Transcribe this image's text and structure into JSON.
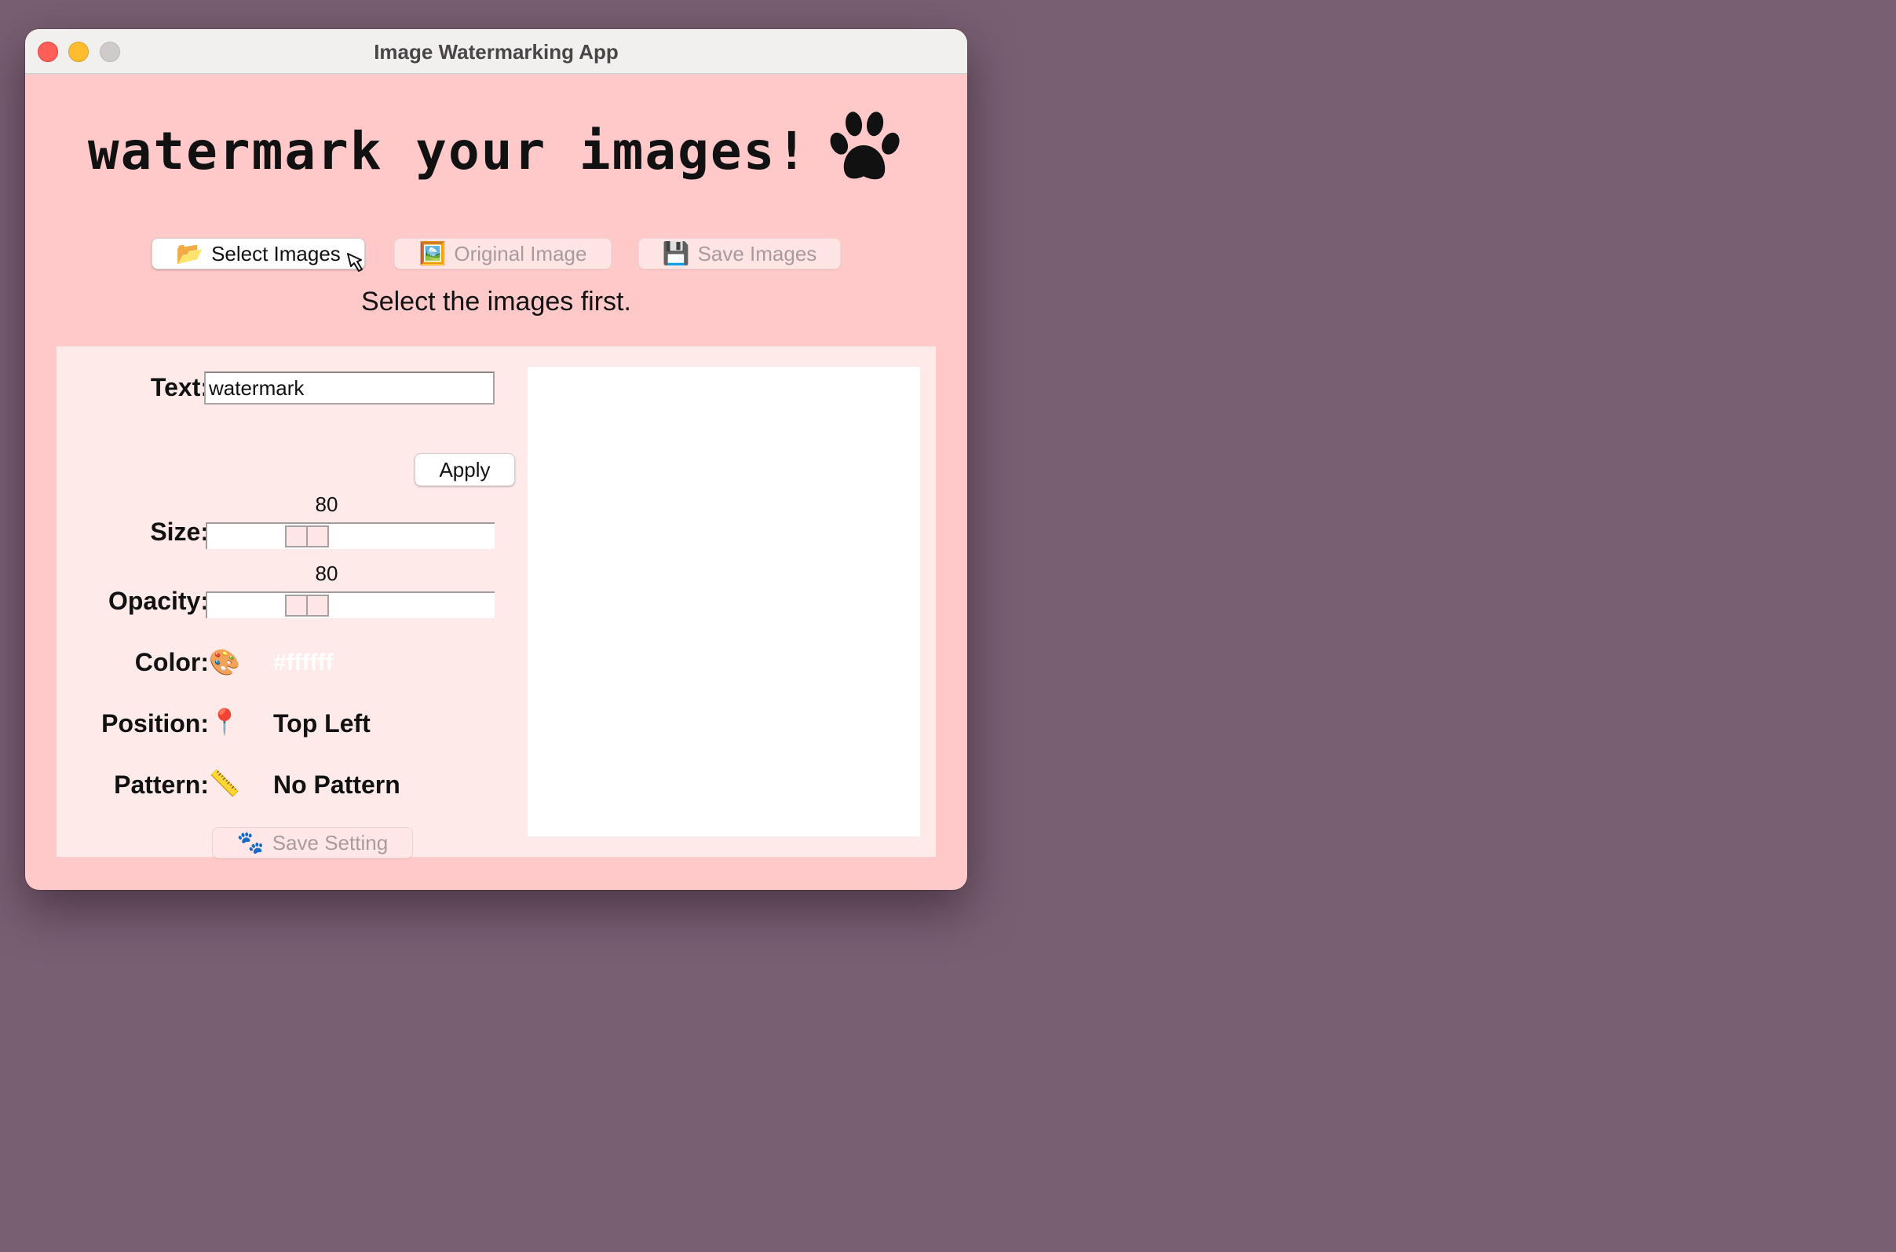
{
  "window": {
    "title": "Image Watermarking App"
  },
  "header": {
    "headline": "watermark your images!",
    "logo_icon": "paw-print-icon"
  },
  "toolbar": {
    "select_images_label": "Select Images",
    "select_images_icon": "📂",
    "original_image_label": "Original Image",
    "original_image_icon": "🖼️",
    "save_images_label": "Save Images",
    "save_images_icon": "💾"
  },
  "status": {
    "message": "Select the images first."
  },
  "settings": {
    "text_label": "Text:",
    "text_value": "watermark",
    "apply_label": "Apply",
    "size_label": "Size:",
    "size_value": "80",
    "size_fraction": 0.32,
    "opacity_label": "Opacity:",
    "opacity_value": "80",
    "opacity_fraction": 0.32,
    "color_label": "Color:",
    "color_icon": "🎨",
    "color_value": "#ffffff",
    "position_label": "Position:",
    "position_icon": "📍",
    "position_value": "Top Left",
    "pattern_label": "Pattern:",
    "pattern_icon": "📏",
    "pattern_value": "No Pattern",
    "save_setting_label": "Save Setting",
    "save_setting_icon": "🐾"
  },
  "colors": {
    "background": "#785f72",
    "window": "#ffc9c9",
    "panel": "#ffeaea",
    "preview": "#ffffff"
  }
}
